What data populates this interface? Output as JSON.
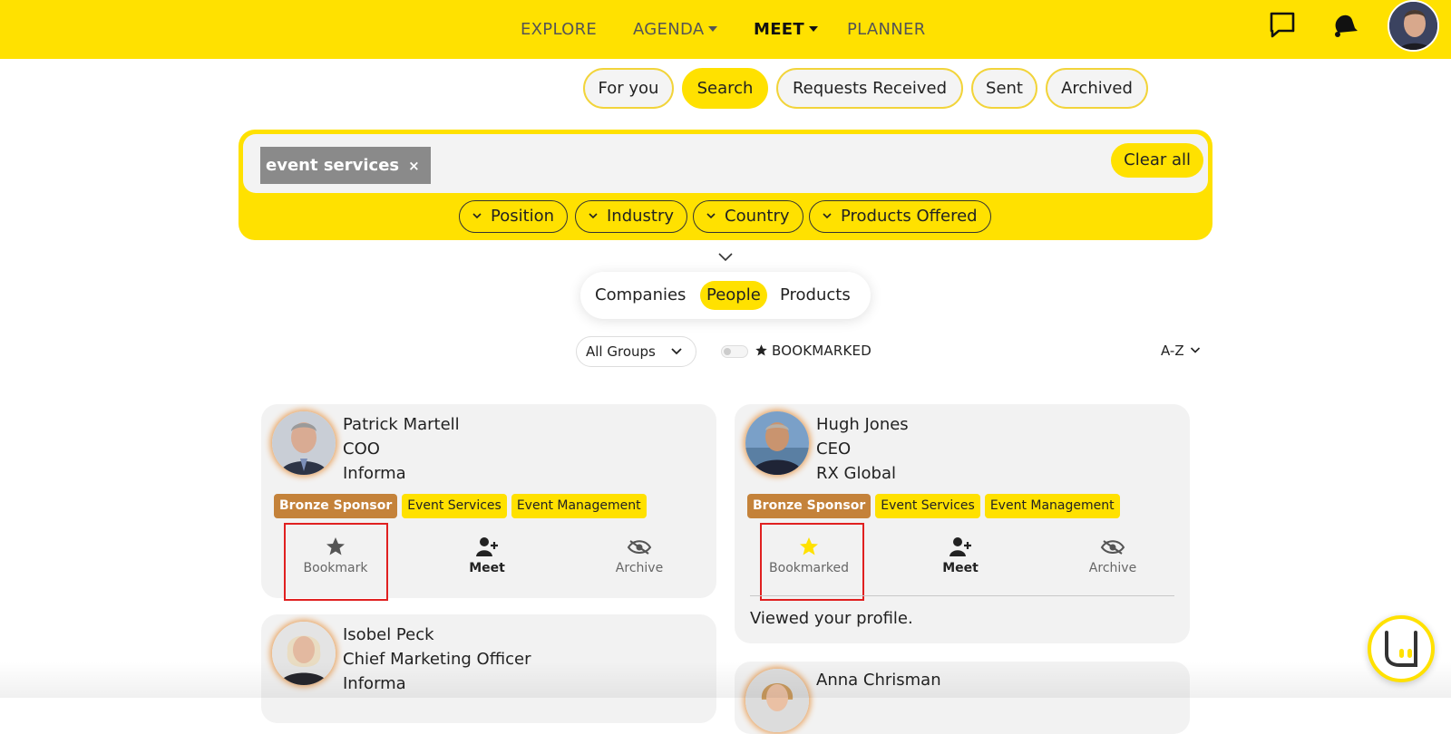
{
  "nav": {
    "explore": "EXPLORE",
    "agenda": "AGENDA",
    "meet": "MEET",
    "planner": "PLANNER"
  },
  "tabs": [
    "For you",
    "Search",
    "Requests Received",
    "Sent",
    "Archived"
  ],
  "active_tab": "Search",
  "search": {
    "chip": "event services",
    "chip_remove": "×",
    "clear_all": "Clear all"
  },
  "filters": [
    "Position",
    "Industry",
    "Country",
    "Products Offered"
  ],
  "segments": [
    "Companies",
    "People",
    "Products"
  ],
  "active_segment": "People",
  "groups_select": "All Groups",
  "bookmarked_toggle": {
    "label": "BOOKMARKED",
    "on": false
  },
  "sort": "A-Z",
  "people": [
    {
      "name": "Patrick Martell",
      "role": "COO",
      "company": "Informa",
      "tags": [
        "Bronze Sponsor",
        "Event Services",
        "Event Management"
      ],
      "bookmark_label": "Bookmark",
      "bookmarked": false,
      "meet_label": "Meet",
      "archive_label": "Archive"
    },
    {
      "name": "Hugh Jones",
      "role": "CEO",
      "company": "RX Global",
      "tags": [
        "Bronze Sponsor",
        "Event Services",
        "Event Management"
      ],
      "bookmark_label": "Bookmarked",
      "bookmarked": true,
      "meet_label": "Meet",
      "archive_label": "Archive",
      "note": "Viewed your profile."
    },
    {
      "name": "Isobel Peck",
      "role": "Chief Marketing Officer",
      "company": "Informa"
    },
    {
      "name": "Anna Chrisman"
    }
  ],
  "colors": {
    "brand_yellow": "#ffe100",
    "bronze": "#c4823a",
    "highlight_red": "#e02020"
  }
}
